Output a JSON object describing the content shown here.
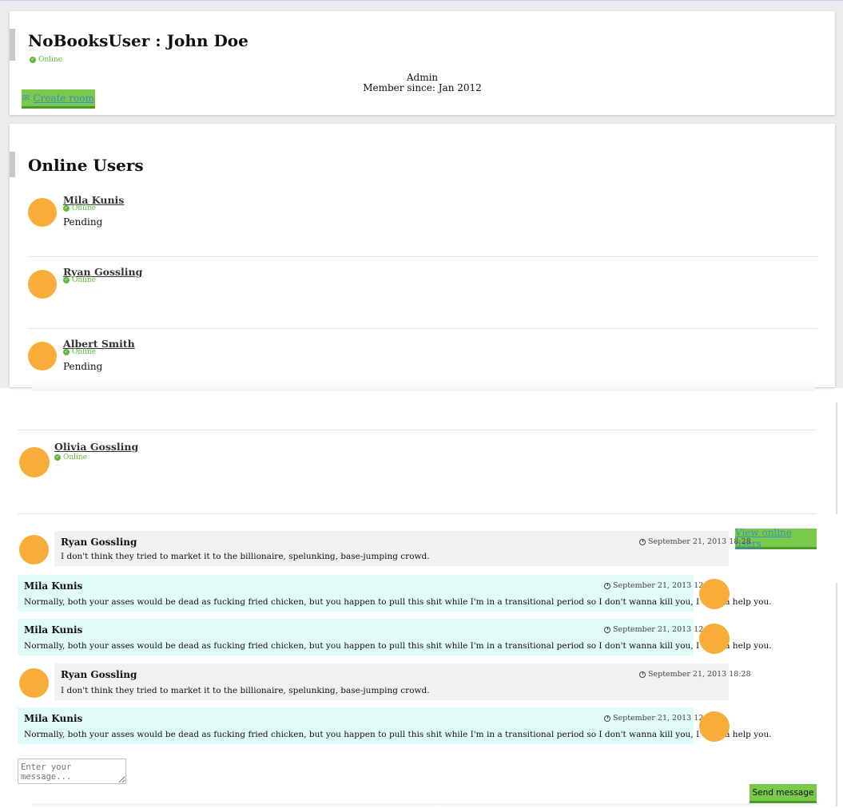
{
  "profile": {
    "title": "NoBooksUser : John Doe",
    "status": "Online",
    "role": "Admin",
    "member_since": "Member since: Jan 2012",
    "create_room_label": "Create room"
  },
  "online_users": {
    "title": "Online Users",
    "users": [
      {
        "name": "Mila Kunis",
        "status": "Online",
        "note": "Pending"
      },
      {
        "name": "Ryan Gossling",
        "status": "Online",
        "note": ""
      },
      {
        "name": "Albert Smith",
        "status": "Online",
        "note": "Pending"
      },
      {
        "name": "Olivia Gossling",
        "status": "Online",
        "note": ""
      }
    ]
  },
  "chat": {
    "view_online_users_label": "View online users",
    "messages": [
      {
        "from": "Ryan Gossling",
        "time": "September 21, 2013 18:28",
        "text": "I don't think they tried to market it to the billionaire, spelunking, base-jumping crowd."
      },
      {
        "from": "Mila Kunis",
        "time": "September 21, 2013 12:45",
        "text": "Normally, both your asses would be dead as fucking fried chicken, but you happen to pull this shit while I'm in a transitional period so I don't wanna kill you, I wanna help you."
      },
      {
        "from": "Mila Kunis",
        "time": "September 21, 2013 12:45",
        "text": "Normally, both your asses would be dead as fucking fried chicken, but you happen to pull this shit while I'm in a transitional period so I don't wanna kill you, I wanna help you."
      },
      {
        "from": "Ryan Gossling",
        "time": "September 21, 2013 18:28",
        "text": "I don't think they tried to market it to the billionaire, spelunking, base-jumping crowd."
      },
      {
        "from": "Mila Kunis",
        "time": "September 21, 2013 12:45",
        "text": "Normally, both your asses would be dead as fucking fried chicken, but you happen to pull this shit while I'm in a transitional period so I don't wanna kill you, I wanna help you."
      }
    ],
    "input_placeholder": "Enter your message...",
    "send_label": "Send message"
  },
  "colors": {
    "accent_green": "#7ac94a",
    "status_green": "#5fb83a",
    "avatar_orange": "#f8ac3a",
    "incoming_bg": "#f1f1f1",
    "outgoing_bg": "#e0fbf8"
  }
}
